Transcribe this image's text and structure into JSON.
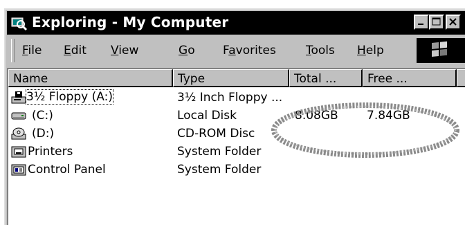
{
  "window": {
    "title": "Exploring - My Computer",
    "controls": {
      "minimize": "minimize",
      "maximize": "maximize",
      "close": "close"
    }
  },
  "menu": [
    {
      "label_pre": "",
      "label_u": "F",
      "label_post": "ile"
    },
    {
      "label_pre": "",
      "label_u": "E",
      "label_post": "dit"
    },
    {
      "label_pre": "",
      "label_u": "V",
      "label_post": "iew"
    },
    {
      "label_pre": "",
      "label_u": "G",
      "label_post": "o"
    },
    {
      "label_pre": "F",
      "label_u": "a",
      "label_post": "vorites"
    },
    {
      "label_pre": "",
      "label_u": "T",
      "label_post": "ools"
    },
    {
      "label_pre": "",
      "label_u": "H",
      "label_post": "elp"
    }
  ],
  "columns": [
    "Name",
    "Type",
    "Total ...",
    "Free ..."
  ],
  "rows": [
    {
      "name": "3½ Floppy (A:)",
      "type": "3½ Inch Floppy ...",
      "total": "",
      "free": "",
      "icon": "floppy-drive-icon"
    },
    {
      "name": "(C:)",
      "type": "Local Disk",
      "total": "8.08GB",
      "free": "7.84GB",
      "icon": "hard-disk-icon"
    },
    {
      "name": "(D:)",
      "type": "CD-ROM Disc",
      "total": "",
      "free": "",
      "icon": "cdrom-drive-icon"
    },
    {
      "name": "Printers",
      "type": "System Folder",
      "total": "",
      "free": "",
      "icon": "printers-folder-icon"
    },
    {
      "name": "Control Panel",
      "type": "System Folder",
      "total": "",
      "free": "",
      "icon": "control-panel-icon"
    }
  ],
  "colors": {
    "face": "#c0c0c0",
    "titlebar": "#000000",
    "annotation": "#8a8a8a"
  }
}
